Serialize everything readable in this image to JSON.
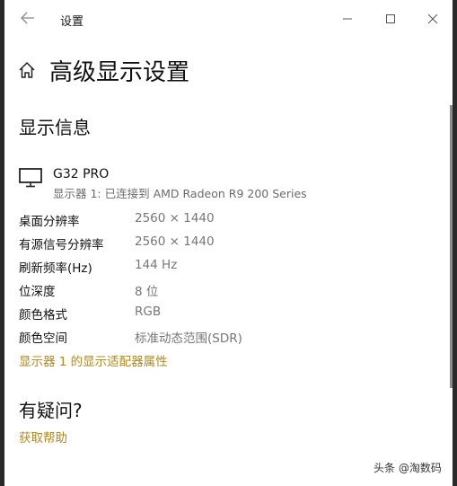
{
  "window": {
    "app_title": "设置"
  },
  "page": {
    "title": "高级显示设置"
  },
  "display_info": {
    "section_title": "显示信息",
    "monitor": {
      "name": "G32 PRO",
      "description": "显示器 1: 已连接到 AMD Radeon R9 200 Series"
    },
    "rows": [
      {
        "label": "桌面分辨率",
        "value": "2560 × 1440"
      },
      {
        "label": "有源信号分辨率",
        "value": "2560 × 1440"
      },
      {
        "label": "刷新频率(Hz)",
        "value": "144 Hz"
      },
      {
        "label": "位深度",
        "value": "8 位"
      },
      {
        "label": "颜色格式",
        "value": "RGB"
      },
      {
        "label": "颜色空间",
        "value": "标准动态范围(SDR)"
      }
    ],
    "adapter_link": "显示器 1 的显示适配器属性"
  },
  "help": {
    "title": "有疑问?",
    "link": "获取帮助"
  },
  "watermark": "头条 @淘数码",
  "colors": {
    "accent_link": "#b08a1c",
    "value_text": "#767676"
  },
  "icons": [
    "back-arrow-icon",
    "minimize-icon",
    "maximize-icon",
    "close-icon",
    "home-icon",
    "monitor-icon"
  ]
}
